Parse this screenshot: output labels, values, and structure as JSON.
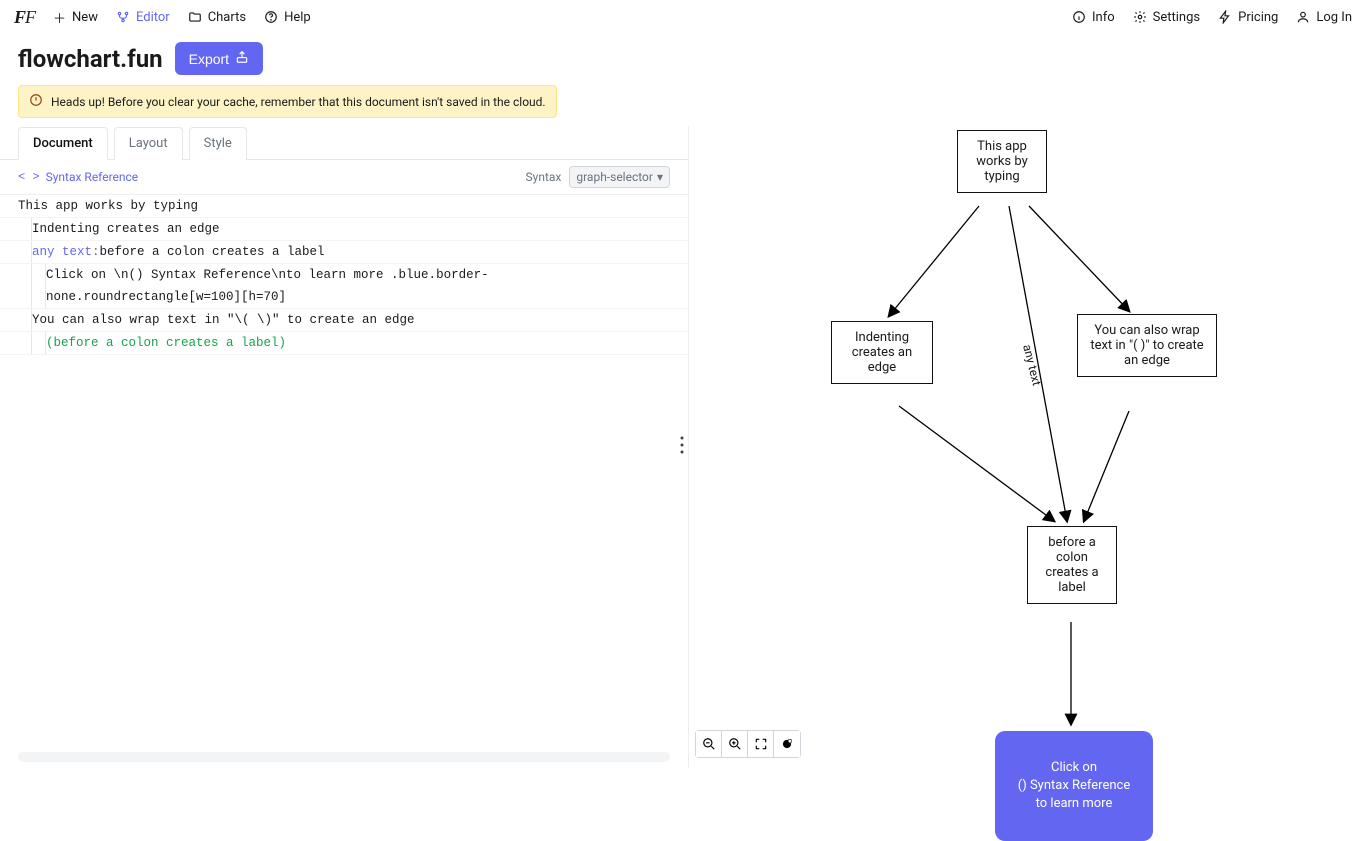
{
  "header": {
    "nav_left": {
      "new": "New",
      "editor": "Editor",
      "charts": "Charts",
      "help": "Help"
    },
    "nav_right": {
      "info": "Info",
      "settings": "Settings",
      "pricing": "Pricing",
      "login": "Log In"
    }
  },
  "title": "flowchart.fun",
  "export_label": "Export",
  "banner_text": "Heads up! Before you clear your cache, remember that this document isn't saved in the cloud.",
  "tabs": {
    "document": "Document",
    "layout": "Layout",
    "style": "Style"
  },
  "syntax": {
    "reference_label": "Syntax Reference",
    "syntax_label": "Syntax",
    "selector_value": "graph-selector"
  },
  "editor_lines": {
    "l1": "This app works by typing",
    "l2": "Indenting creates an edge",
    "l3_label": "any text:",
    "l3_rest": " before a colon creates a label",
    "l4": "Click on \\n() Syntax Reference\\nto learn more .blue.border-none.roundrectangle[w=100][h=70]",
    "l5": "You can also wrap text in \"\\( \\)\" to create an edge",
    "l6": "(before a colon creates a label)"
  },
  "flow": {
    "node1": "This app works by typing",
    "node2": "Indenting creates an edge",
    "node3": "You can also wrap text in \"( )\" to create an edge",
    "node4": "before a colon creates a label",
    "node5_l1": "Click on",
    "node5_l2": "() Syntax Reference",
    "node5_l3": "to learn more",
    "edge_label": "any text"
  },
  "controls": {
    "zoom_out": "−",
    "zoom_in": "+",
    "fit": "⛶",
    "reset": "⦿"
  }
}
